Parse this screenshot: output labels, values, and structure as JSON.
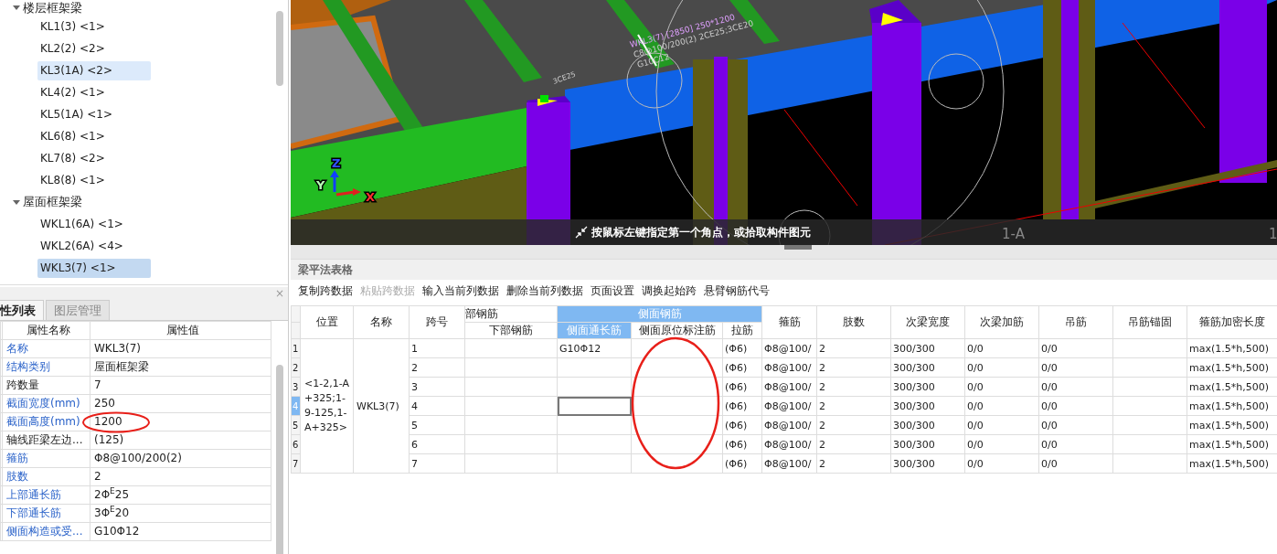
{
  "tree": [
    {
      "label": "楼层框架梁",
      "expanded": true,
      "children": [
        {
          "label": "KL1(3) <1>",
          "selected": false,
          "hovered": false
        },
        {
          "label": "KL2(2) <2>",
          "selected": false,
          "hovered": false
        },
        {
          "label": "KL3(1A) <2>",
          "selected": false,
          "hovered": true
        },
        {
          "label": "KL4(2) <1>",
          "selected": false,
          "hovered": false
        },
        {
          "label": "KL5(1A) <1>",
          "selected": false,
          "hovered": false
        },
        {
          "label": "KL6(8) <1>",
          "selected": false,
          "hovered": false
        },
        {
          "label": "KL7(8) <2>",
          "selected": false,
          "hovered": false
        },
        {
          "label": "KL8(8) <1>",
          "selected": false,
          "hovered": false
        }
      ]
    },
    {
      "label": "屋面框架梁",
      "expanded": true,
      "children": [
        {
          "label": "WKL1(6A) <1>",
          "selected": false,
          "hovered": false
        },
        {
          "label": "WKL2(6A) <4>",
          "selected": false,
          "hovered": false
        },
        {
          "label": "WKL3(7) <1>",
          "selected": true,
          "hovered": false
        }
      ]
    }
  ],
  "properties": {
    "close": "×",
    "tabs": [
      {
        "label": "性列表",
        "selected": true
      },
      {
        "label": "图层管理",
        "selected": false
      }
    ],
    "columns": [
      "属性名称",
      "属性值"
    ],
    "rows": [
      {
        "name": "名称",
        "value": "WKL3(7)",
        "public": true
      },
      {
        "name": "结构类别",
        "value": "屋面框架梁",
        "public": true
      },
      {
        "name": "跨数量",
        "value": "7",
        "public": false
      },
      {
        "name": "截面宽度(mm)",
        "value": "250",
        "public": true
      },
      {
        "name": "截面高度(mm)",
        "value": "1200",
        "public": true
      },
      {
        "name": "轴线距梁左边...",
        "value": "(125)",
        "public": false
      },
      {
        "name": "箍筋",
        "value": "Φ8@100/200(2)",
        "public": true
      },
      {
        "name": "肢数",
        "value": "2",
        "public": true
      },
      {
        "name": "上部通长筋",
        "value": "2Φ$^{E}$25",
        "public": true
      },
      {
        "name": "下部通长筋",
        "value": "3Φ$^{E}$20",
        "public": true
      },
      {
        "name": "侧面构造或受...",
        "value": "G10Φ12",
        "public": true
      }
    ]
  },
  "view3d": {
    "annotations": [
      "WKL3(7) [2850] 250*1200",
      "C8@100/200(2) 2CE25;3CE20",
      "G10C12"
    ],
    "label_3ce25": "3CE25",
    "axes": [
      "X",
      "Y",
      "Z"
    ],
    "hint": "按鼠标左键指定第一个角点，或拾取构件图元",
    "axis_labels": [
      "1-A",
      "1"
    ]
  },
  "beam_table": {
    "title": "梁平法表格",
    "toolbar": [
      {
        "label": "复制跨数据",
        "disabled": false
      },
      {
        "label": "粘贴跨数据",
        "disabled": true
      },
      {
        "label": "输入当前列数据",
        "disabled": false
      },
      {
        "label": "删除当前列数据",
        "disabled": false
      },
      {
        "label": "页面设置",
        "disabled": false
      },
      {
        "label": "调换起始跨",
        "disabled": false
      },
      {
        "label": "悬臂钢筋代号",
        "disabled": false
      }
    ],
    "header": [
      {
        "kind": "single",
        "label": "位置",
        "selected": false
      },
      {
        "kind": "single",
        "label": "名称",
        "selected": false
      },
      {
        "kind": "single",
        "label": "跨号",
        "selected": false
      },
      {
        "kind": "group",
        "label": "部钢筋",
        "selected": false,
        "columns": [
          {
            "label": "下部钢筋",
            "selected": false
          }
        ]
      },
      {
        "kind": "group",
        "label": "侧面钢筋",
        "selected": true,
        "columns": [
          {
            "label": "侧面通长筋",
            "selected": true
          },
          {
            "label": "侧面原位标注筋",
            "selected": false
          },
          {
            "label": "拉筋",
            "selected": false
          }
        ]
      },
      {
        "kind": "single",
        "label": "箍筋",
        "selected": false
      },
      {
        "kind": "single",
        "label": "肢数",
        "selected": false
      },
      {
        "kind": "single",
        "label": "次梁宽度",
        "selected": false
      },
      {
        "kind": "single",
        "label": "次梁加筋",
        "selected": false
      },
      {
        "kind": "single",
        "label": "吊筋",
        "selected": false
      },
      {
        "kind": "single",
        "label": "吊筋锚固",
        "selected": false
      },
      {
        "kind": "single",
        "label": "箍筋加密长度",
        "selected": false
      }
    ],
    "position": "<1-2,1-A+325;1-9-125,1-A+325>",
    "name": "WKL3(7)",
    "rows": [
      {
        "number": "1",
        "selected": false,
        "cells": [
          "1",
          null,
          "G10Φ12",
          null,
          "(Φ6)",
          "Φ8@100/",
          "2",
          "300/300",
          "0/0",
          "0/0",
          null,
          "max(1.5*h,500)"
        ]
      },
      {
        "number": "2",
        "selected": false,
        "cells": [
          "2",
          null,
          null,
          null,
          "(Φ6)",
          "Φ8@100/",
          "2",
          "300/300",
          "0/0",
          "0/0",
          null,
          "max(1.5*h,500)"
        ]
      },
      {
        "number": "3",
        "selected": false,
        "cells": [
          "3",
          null,
          null,
          null,
          "(Φ6)",
          "Φ8@100/",
          "2",
          "300/300",
          "0/0",
          "0/0",
          null,
          "max(1.5*h,500)"
        ]
      },
      {
        "number": "4",
        "selected": true,
        "cells": [
          "4",
          null,
          null,
          null,
          "(Φ6)",
          "Φ8@100/",
          "2",
          "300/300",
          "0/0",
          "0/0",
          null,
          "max(1.5*h,500)"
        ]
      },
      {
        "number": "5",
        "selected": false,
        "cells": [
          "5",
          null,
          null,
          null,
          "(Φ6)",
          "Φ8@100/",
          "2",
          "300/300",
          "0/0",
          "0/0",
          null,
          "max(1.5*h,500)"
        ]
      },
      {
        "number": "6",
        "selected": false,
        "cells": [
          "6",
          null,
          null,
          null,
          "(Φ6)",
          "Φ8@100/",
          "2",
          "300/300",
          "0/0",
          "0/0",
          null,
          "max(1.5*h,500)"
        ]
      },
      {
        "number": "7",
        "selected": false,
        "cells": [
          "7",
          null,
          null,
          null,
          "(Φ6)",
          "Φ8@100/",
          "2",
          "300/300",
          "0/0",
          "0/0",
          null,
          "max(1.5*h,500)"
        ]
      }
    ]
  }
}
